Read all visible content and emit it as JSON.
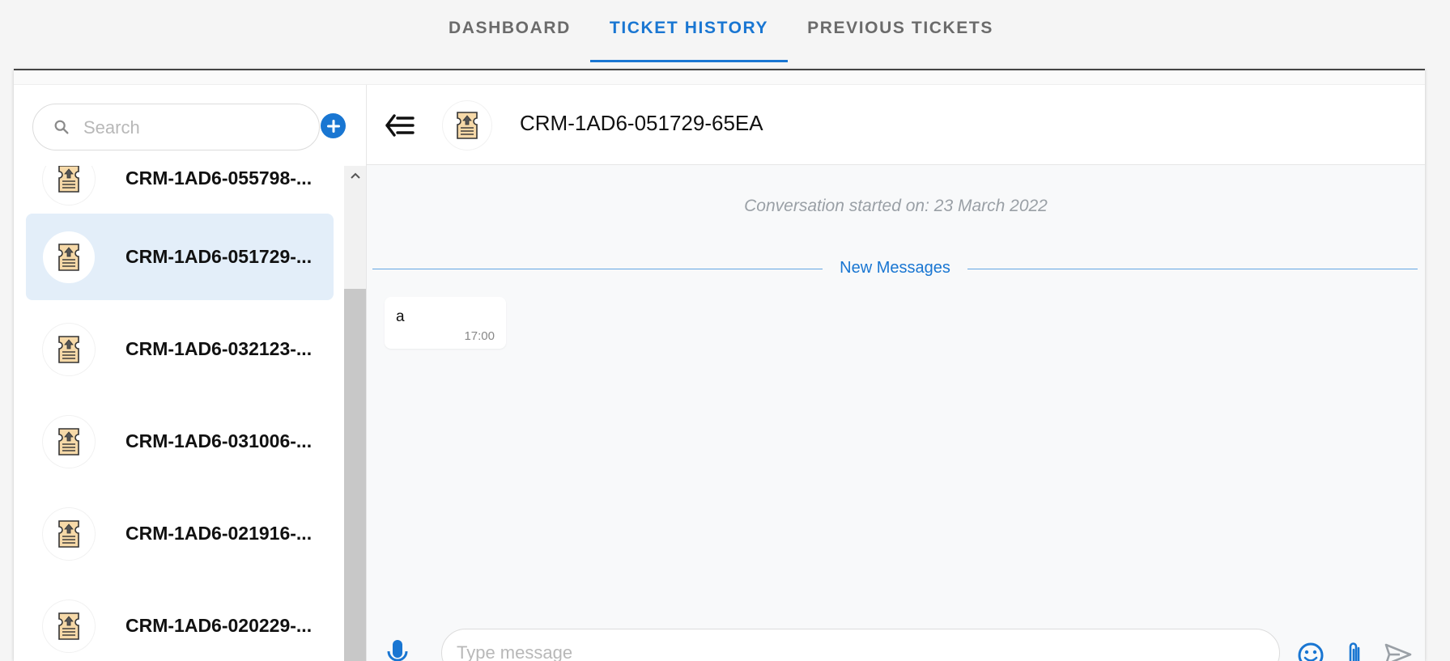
{
  "tabs": [
    {
      "label": "DASHBOARD",
      "active": false
    },
    {
      "label": "TICKET HISTORY",
      "active": true
    },
    {
      "label": "PREVIOUS TICKETS",
      "active": false
    }
  ],
  "sidebar": {
    "search_placeholder": "Search",
    "add_icon": "plus-circle-icon",
    "items": [
      {
        "label": "CRM-1AD6-055798-...",
        "selected": false,
        "icon": "ticket-icon"
      },
      {
        "label": "CRM-1AD6-051729-...",
        "selected": true,
        "icon": "ticket-icon"
      },
      {
        "label": "CRM-1AD6-032123-...",
        "selected": false,
        "icon": "ticket-icon"
      },
      {
        "label": "CRM-1AD6-031006-...",
        "selected": false,
        "icon": "ticket-icon"
      },
      {
        "label": "CRM-1AD6-021916-...",
        "selected": false,
        "icon": "ticket-icon"
      },
      {
        "label": "CRM-1AD6-020229-...",
        "selected": false,
        "icon": "ticket-icon"
      }
    ]
  },
  "chat": {
    "title": "CRM-1AD6-051729-65EA",
    "started_text": "Conversation started on: 23 March 2022",
    "divider_label": "New Messages",
    "messages": [
      {
        "text": "a",
        "time": "17:00"
      }
    ],
    "input_placeholder": "Type message"
  },
  "colors": {
    "accent": "#1976d2",
    "selected_bg": "#e3eef9",
    "ticket_fill": "#f6d9a8"
  }
}
